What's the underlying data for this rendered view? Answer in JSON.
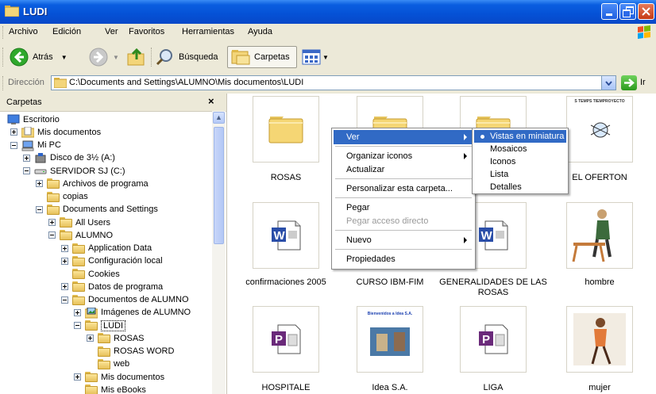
{
  "window": {
    "title": "LUDI"
  },
  "menubar": [
    "Archivo",
    "Edición",
    "Ver",
    "Favoritos",
    "Herramientas",
    "Ayuda"
  ],
  "toolbar": {
    "back": "Atrás",
    "search": "Búsqueda",
    "folders": "Carpetas"
  },
  "address": {
    "label": "Dirección",
    "path": "C:\\Documents and Settings\\ALUMNO\\Mis documentos\\LUDI",
    "go": "Ir"
  },
  "folders_pane": {
    "title": "Carpetas",
    "close": "×",
    "tree": [
      {
        "label": "Escritorio",
        "level": 0,
        "expander": "none",
        "icon": "desktop-icon"
      },
      {
        "label": "Mis documentos",
        "level": 1,
        "expander": "plus",
        "icon": "my-documents-icon"
      },
      {
        "label": "Mi PC",
        "level": 1,
        "expander": "minus",
        "icon": "my-computer-icon"
      },
      {
        "label": "Disco de 3½ (A:)",
        "level": 2,
        "expander": "plus",
        "icon": "floppy-icon"
      },
      {
        "label": "SERVIDOR SJ (C:)",
        "level": 2,
        "expander": "minus",
        "icon": "drive-icon"
      },
      {
        "label": "Archivos de programa",
        "level": 3,
        "expander": "plus",
        "icon": "folder-icon"
      },
      {
        "label": "copias",
        "level": 3,
        "expander": "none",
        "icon": "folder-icon"
      },
      {
        "label": "Documents and Settings",
        "level": 3,
        "expander": "minus",
        "icon": "folder-icon"
      },
      {
        "label": "All Users",
        "level": 4,
        "expander": "plus",
        "icon": "folder-icon"
      },
      {
        "label": "ALUMNO",
        "level": 4,
        "expander": "minus",
        "icon": "folder-icon"
      },
      {
        "label": "Application Data",
        "level": 5,
        "expander": "plus",
        "icon": "folder-icon"
      },
      {
        "label": "Configuración local",
        "level": 5,
        "expander": "plus",
        "icon": "folder-icon"
      },
      {
        "label": "Cookies",
        "level": 5,
        "expander": "none",
        "icon": "folder-icon"
      },
      {
        "label": "Datos de programa",
        "level": 5,
        "expander": "plus",
        "icon": "folder-icon"
      },
      {
        "label": "Documentos de ALUMNO",
        "level": 5,
        "expander": "minus",
        "icon": "folder-icon"
      },
      {
        "label": "Imágenes de ALUMNO",
        "level": 6,
        "expander": "plus",
        "icon": "pictures-folder-icon"
      },
      {
        "label": "LUDI",
        "level": 6,
        "expander": "minus",
        "icon": "folder-open-icon",
        "selected": true
      },
      {
        "label": "ROSAS",
        "level": 7,
        "expander": "plus",
        "icon": "folder-icon"
      },
      {
        "label": "ROSAS WORD",
        "level": 7,
        "expander": "none",
        "icon": "folder-icon"
      },
      {
        "label": "web",
        "level": 7,
        "expander": "none",
        "icon": "folder-icon"
      },
      {
        "label": "Mis documentos",
        "level": 6,
        "expander": "plus",
        "icon": "folder-icon"
      },
      {
        "label": "Mis eBooks",
        "level": 6,
        "expander": "none",
        "icon": "folder-icon"
      }
    ]
  },
  "files": [
    {
      "label": "ROSAS",
      "type": "folder"
    },
    {
      "label": "",
      "type": "folder"
    },
    {
      "label": "",
      "type": "folder"
    },
    {
      "label": "EL OFERTON",
      "type": "image-doc",
      "thumb_caption": "S TEMPS  TIEMPROYECTO"
    },
    {
      "label": "confirmaciones 2005",
      "type": "word"
    },
    {
      "label": "CURSO IBM-FIM",
      "type": "generic"
    },
    {
      "label": "GENERALIDADES DE LAS ROSAS",
      "type": "word"
    },
    {
      "label": "hombre",
      "type": "clipart-man"
    },
    {
      "label": "HOSPITALE",
      "type": "publisher"
    },
    {
      "label": "Idea S.A.",
      "type": "photo-doc",
      "thumb_caption": "Bienvenidos a Idea S.A."
    },
    {
      "label": "LIGA",
      "type": "publisher"
    },
    {
      "label": "mujer",
      "type": "photo-woman"
    }
  ],
  "context_menu": [
    {
      "label": "Ver",
      "submenu": true,
      "highlighted": true
    },
    {
      "sep": true
    },
    {
      "label": "Organizar iconos",
      "submenu": true
    },
    {
      "label": "Actualizar"
    },
    {
      "sep": true
    },
    {
      "label": "Personalizar esta carpeta..."
    },
    {
      "sep": true
    },
    {
      "label": "Pegar"
    },
    {
      "label": "Pegar acceso directo",
      "disabled": true
    },
    {
      "sep": true
    },
    {
      "label": "Nuevo",
      "submenu": true
    },
    {
      "sep": true
    },
    {
      "label": "Propiedades"
    }
  ],
  "submenu_view": [
    {
      "label": "Vistas en miniatura",
      "selected": true
    },
    {
      "label": "Mosaicos"
    },
    {
      "label": "Iconos"
    },
    {
      "label": "Lista"
    },
    {
      "label": "Detalles"
    }
  ],
  "colors": {
    "titlebar": "#0551d6",
    "highlight": "#316ac5",
    "chrome": "#ece9d8"
  }
}
